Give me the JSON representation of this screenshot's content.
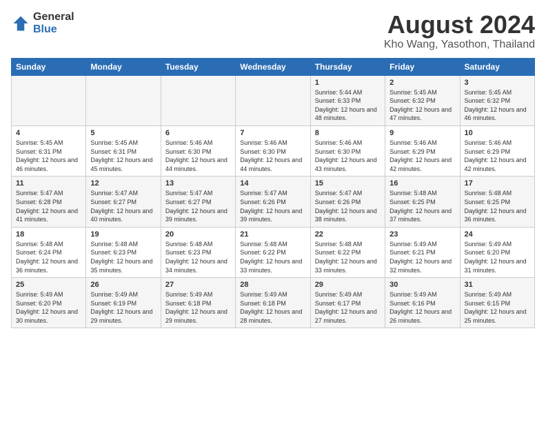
{
  "logo": {
    "general": "General",
    "blue": "Blue"
  },
  "title": "August 2024",
  "subtitle": "Kho Wang, Yasothon, Thailand",
  "days_of_week": [
    "Sunday",
    "Monday",
    "Tuesday",
    "Wednesday",
    "Thursday",
    "Friday",
    "Saturday"
  ],
  "weeks": [
    [
      {
        "day": "",
        "content": ""
      },
      {
        "day": "",
        "content": ""
      },
      {
        "day": "",
        "content": ""
      },
      {
        "day": "",
        "content": ""
      },
      {
        "day": "1",
        "content": "Sunrise: 5:44 AM\nSunset: 6:33 PM\nDaylight: 12 hours and 48 minutes."
      },
      {
        "day": "2",
        "content": "Sunrise: 5:45 AM\nSunset: 6:32 PM\nDaylight: 12 hours and 47 minutes."
      },
      {
        "day": "3",
        "content": "Sunrise: 5:45 AM\nSunset: 6:32 PM\nDaylight: 12 hours and 46 minutes."
      }
    ],
    [
      {
        "day": "4",
        "content": "Sunrise: 5:45 AM\nSunset: 6:31 PM\nDaylight: 12 hours and 46 minutes."
      },
      {
        "day": "5",
        "content": "Sunrise: 5:45 AM\nSunset: 6:31 PM\nDaylight: 12 hours and 45 minutes."
      },
      {
        "day": "6",
        "content": "Sunrise: 5:46 AM\nSunset: 6:30 PM\nDaylight: 12 hours and 44 minutes."
      },
      {
        "day": "7",
        "content": "Sunrise: 5:46 AM\nSunset: 6:30 PM\nDaylight: 12 hours and 44 minutes."
      },
      {
        "day": "8",
        "content": "Sunrise: 5:46 AM\nSunset: 6:30 PM\nDaylight: 12 hours and 43 minutes."
      },
      {
        "day": "9",
        "content": "Sunrise: 5:46 AM\nSunset: 6:29 PM\nDaylight: 12 hours and 42 minutes."
      },
      {
        "day": "10",
        "content": "Sunrise: 5:46 AM\nSunset: 6:29 PM\nDaylight: 12 hours and 42 minutes."
      }
    ],
    [
      {
        "day": "11",
        "content": "Sunrise: 5:47 AM\nSunset: 6:28 PM\nDaylight: 12 hours and 41 minutes."
      },
      {
        "day": "12",
        "content": "Sunrise: 5:47 AM\nSunset: 6:27 PM\nDaylight: 12 hours and 40 minutes."
      },
      {
        "day": "13",
        "content": "Sunrise: 5:47 AM\nSunset: 6:27 PM\nDaylight: 12 hours and 39 minutes."
      },
      {
        "day": "14",
        "content": "Sunrise: 5:47 AM\nSunset: 6:26 PM\nDaylight: 12 hours and 39 minutes."
      },
      {
        "day": "15",
        "content": "Sunrise: 5:47 AM\nSunset: 6:26 PM\nDaylight: 12 hours and 38 minutes."
      },
      {
        "day": "16",
        "content": "Sunrise: 5:48 AM\nSunset: 6:25 PM\nDaylight: 12 hours and 37 minutes."
      },
      {
        "day": "17",
        "content": "Sunrise: 5:48 AM\nSunset: 6:25 PM\nDaylight: 12 hours and 36 minutes."
      }
    ],
    [
      {
        "day": "18",
        "content": "Sunrise: 5:48 AM\nSunset: 6:24 PM\nDaylight: 12 hours and 36 minutes."
      },
      {
        "day": "19",
        "content": "Sunrise: 5:48 AM\nSunset: 6:23 PM\nDaylight: 12 hours and 35 minutes."
      },
      {
        "day": "20",
        "content": "Sunrise: 5:48 AM\nSunset: 6:23 PM\nDaylight: 12 hours and 34 minutes."
      },
      {
        "day": "21",
        "content": "Sunrise: 5:48 AM\nSunset: 6:22 PM\nDaylight: 12 hours and 33 minutes."
      },
      {
        "day": "22",
        "content": "Sunrise: 5:48 AM\nSunset: 6:22 PM\nDaylight: 12 hours and 33 minutes."
      },
      {
        "day": "23",
        "content": "Sunrise: 5:49 AM\nSunset: 6:21 PM\nDaylight: 12 hours and 32 minutes."
      },
      {
        "day": "24",
        "content": "Sunrise: 5:49 AM\nSunset: 6:20 PM\nDaylight: 12 hours and 31 minutes."
      }
    ],
    [
      {
        "day": "25",
        "content": "Sunrise: 5:49 AM\nSunset: 6:20 PM\nDaylight: 12 hours and 30 minutes."
      },
      {
        "day": "26",
        "content": "Sunrise: 5:49 AM\nSunset: 6:19 PM\nDaylight: 12 hours and 29 minutes."
      },
      {
        "day": "27",
        "content": "Sunrise: 5:49 AM\nSunset: 6:18 PM\nDaylight: 12 hours and 29 minutes."
      },
      {
        "day": "28",
        "content": "Sunrise: 5:49 AM\nSunset: 6:18 PM\nDaylight: 12 hours and 28 minutes."
      },
      {
        "day": "29",
        "content": "Sunrise: 5:49 AM\nSunset: 6:17 PM\nDaylight: 12 hours and 27 minutes."
      },
      {
        "day": "30",
        "content": "Sunrise: 5:49 AM\nSunset: 6:16 PM\nDaylight: 12 hours and 26 minutes."
      },
      {
        "day": "31",
        "content": "Sunrise: 5:49 AM\nSunset: 6:15 PM\nDaylight: 12 hours and 25 minutes."
      }
    ]
  ]
}
